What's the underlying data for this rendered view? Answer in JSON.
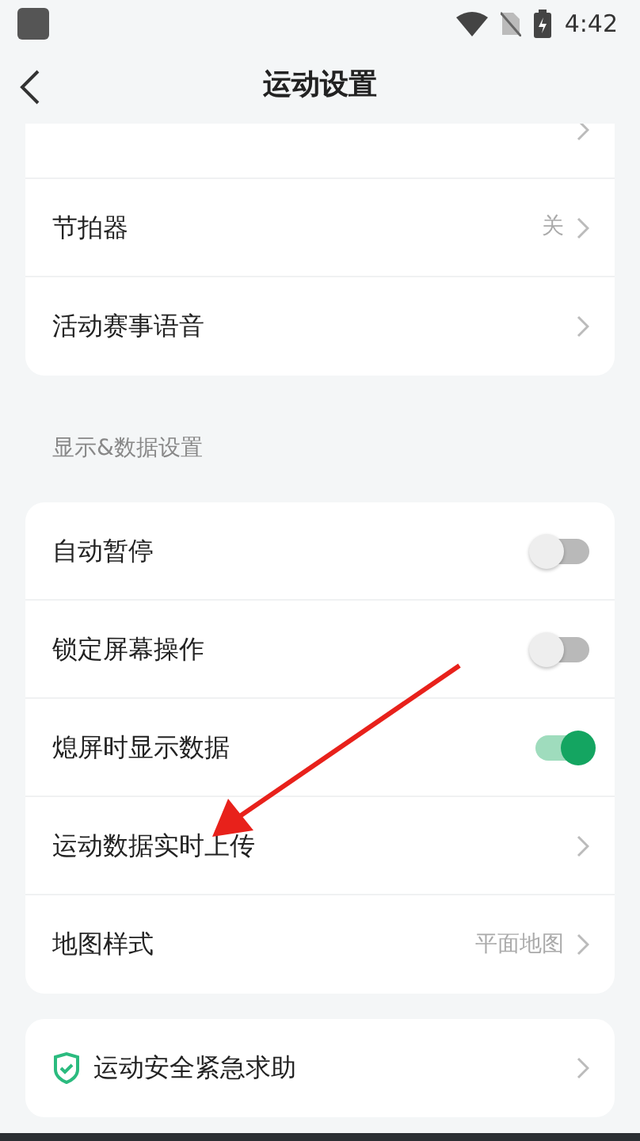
{
  "status_bar": {
    "time": "4:42"
  },
  "header": {
    "title": "运动设置"
  },
  "groups": [
    {
      "rows": [
        {
          "kind": "link"
        },
        {
          "kind": "link",
          "label": "节拍器",
          "value": "关"
        },
        {
          "kind": "link",
          "label": "活动赛事语音"
        }
      ]
    },
    {
      "section_title": "显示&数据设置",
      "rows": [
        {
          "kind": "toggle",
          "label": "自动暂停",
          "on": false
        },
        {
          "kind": "toggle",
          "label": "锁定屏幕操作",
          "on": false
        },
        {
          "kind": "toggle",
          "label": "熄屏时显示数据",
          "on": true
        },
        {
          "kind": "link",
          "label": "运动数据实时上传"
        },
        {
          "kind": "link",
          "label": "地图样式",
          "value": "平面地图"
        }
      ]
    },
    {
      "rows": [
        {
          "kind": "safety",
          "label": "运动安全紧急求助"
        }
      ]
    }
  ]
}
